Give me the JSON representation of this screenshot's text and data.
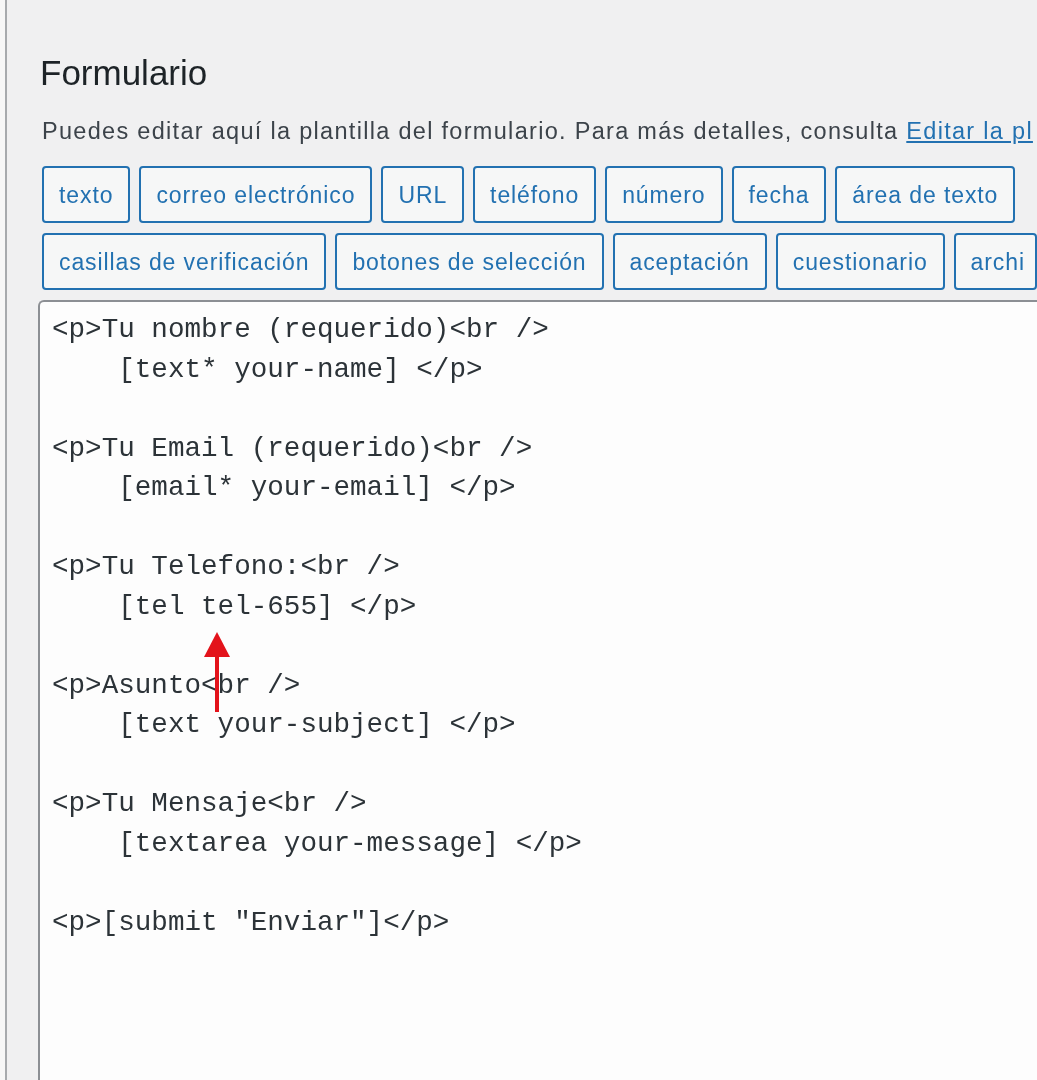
{
  "section": {
    "title": "Formulario",
    "description": "Puedes editar aquí la plantilla del formulario. Para más detalles, consulta",
    "link": "Editar la pl"
  },
  "tag_button_rows": [
    {
      "buttons": [
        "texto",
        "correo electrónico",
        "URL",
        "teléfono",
        "número",
        "fecha",
        "área de texto"
      ]
    },
    {
      "buttons": [
        "casillas de verificación",
        "botones de selección",
        "aceptación",
        "cuestionario",
        "archi"
      ]
    }
  ],
  "editor": {
    "blocks": [
      {
        "lines": [
          "<p>Tu nombre (requerido)<br />",
          "    [text* your-name] </p>"
        ]
      },
      {
        "lines": [
          "<p>Tu Email (requerido)<br />",
          "    [email* your-email] </p>"
        ]
      },
      {
        "lines": [
          "<p>Tu Telefono:<br />",
          "    [tel tel-655] </p>"
        ]
      },
      {
        "lines": [
          "<p>Asunto<br />",
          "    [text your-subject] </p>"
        ]
      },
      {
        "lines": [
          "<p>Tu Mensaje<br />",
          "    [textarea your-message] </p>"
        ]
      },
      {
        "lines": [
          "<p>[submit \"Enviar\"]</p>"
        ]
      }
    ]
  }
}
